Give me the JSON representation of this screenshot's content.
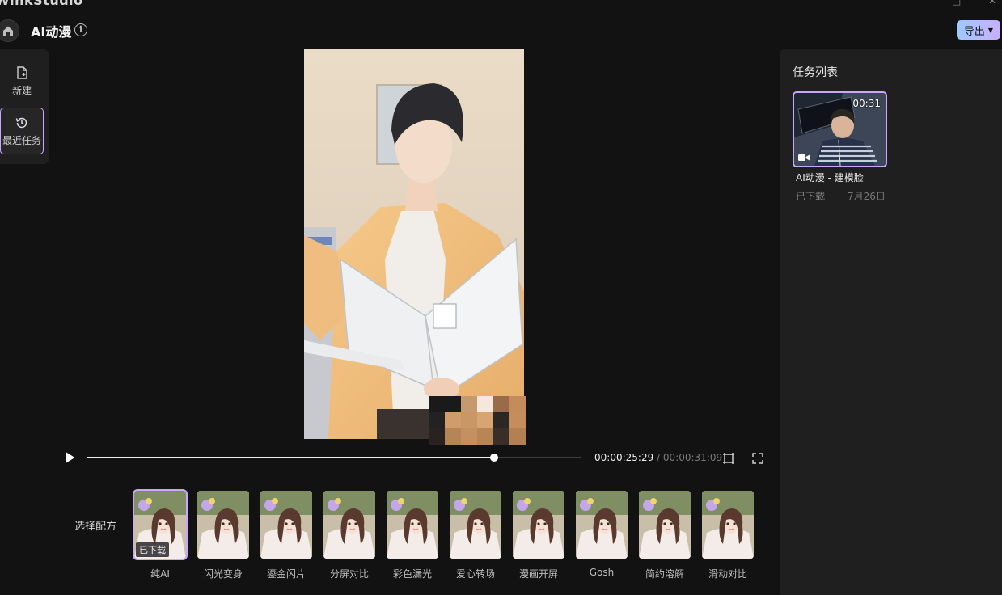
{
  "app": {
    "name": "WinkStudio",
    "window_controls": [
      "□",
      "✕"
    ]
  },
  "header": {
    "title": "AI动漫",
    "info_icon": "info-icon",
    "export_label": "导出"
  },
  "sidebar": {
    "items": [
      {
        "label": "新建",
        "icon": "new-file-icon"
      },
      {
        "label": "最近任务",
        "icon": "history-icon",
        "selected": true
      }
    ]
  },
  "player": {
    "current_time": "00:00:25:29",
    "separator": "/",
    "total_time": "00:00:31:09",
    "progress": 0.825
  },
  "presets": {
    "label": "选择配方",
    "downloaded_badge": "已下载",
    "items": [
      {
        "name": "纯AI",
        "selected": true
      },
      {
        "name": "闪光变身"
      },
      {
        "name": "鎏金闪片"
      },
      {
        "name": "分屏对比"
      },
      {
        "name": "彩色漏光"
      },
      {
        "name": "爱心转场"
      },
      {
        "name": "漫画开屏"
      },
      {
        "name": "Gosh"
      },
      {
        "name": "简约溶解"
      },
      {
        "name": "滑动对比"
      }
    ]
  },
  "task_panel": {
    "title": "任务列表",
    "tasks": [
      {
        "duration": "00:31",
        "name": "AI动漫 - 建模脸",
        "status": "已下载",
        "date": "7月26日"
      }
    ]
  },
  "colors": {
    "accent": "#c9a6ff",
    "export_gradient_start": "#9ec8ff",
    "export_gradient_end": "#c8b0ff",
    "panel_bg": "#1f1f1f",
    "app_bg": "#121212"
  }
}
